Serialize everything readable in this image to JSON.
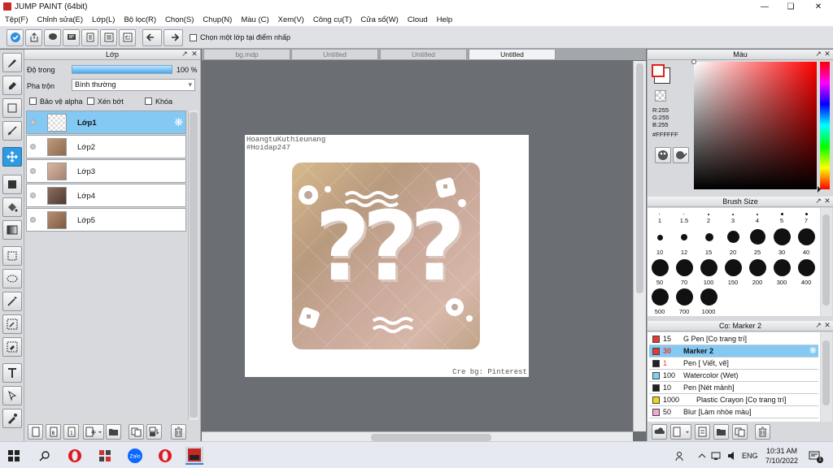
{
  "window": {
    "title": "JUMP PAINT (64bit)"
  },
  "menu": [
    "Tệp(F)",
    "Chỉnh sửa(E)",
    "Lớp(L)",
    "Bộ lọc(R)",
    "Chọn(S)",
    "Chụp(N)",
    "Màu (C)",
    "Xem(V)",
    "Công cụ(T)",
    "Cửa sổ(W)",
    "Cloud",
    "Help"
  ],
  "toolbar": {
    "select_layer_label": "Chọn một lớp tại điểm nhấp"
  },
  "layer_panel": {
    "title": "Lớp",
    "opacity_label": "Độ trong",
    "opacity_value": "100 %",
    "opacity_fraction": 1.0,
    "blend_label": "Pha trộn",
    "blend_value": "Bình thường",
    "protect_alpha": "Bảo vệ alpha",
    "clipping": "Xén bớt",
    "lock": "Khóa",
    "layers": [
      "Lớp1",
      "Lớp2",
      "Lớp3",
      "Lớp4",
      "Lớp5"
    ]
  },
  "tabs": [
    "bg.mdp",
    "Untitled",
    "Untitled",
    "Untitled"
  ],
  "canvas": {
    "watermark_line1": "HoangtuKuthieunang",
    "watermark_line2": "#Hoidap247",
    "credit": "Cre bg: Pinterest",
    "question_marks": "???"
  },
  "color_panel": {
    "title": "Màu",
    "r": "R:255",
    "g": "G:255",
    "b": "B:255",
    "hex": "#FFFFFF",
    "accent": "#ff2a2a"
  },
  "brush_size_panel": {
    "title": "Brush Size",
    "sizes": [
      "1",
      "1.5",
      "2",
      "3",
      "4",
      "5",
      "7",
      "10",
      "12",
      "15",
      "20",
      "25",
      "30",
      "40",
      "50",
      "70",
      "100",
      "150",
      "200",
      "300",
      "400",
      "500",
      "700",
      "1000"
    ]
  },
  "brush_panel": {
    "title": "Cọ: Marker 2",
    "brushes": [
      {
        "size": "15",
        "name": "G Pen [Cọ trang trí]",
        "color": "#e53935"
      },
      {
        "size": "30",
        "name": "Marker 2",
        "color": "#e53935"
      },
      {
        "size": "1",
        "name": "Pen [ Viết, vẽ]",
        "color": "#222222"
      },
      {
        "size": "100",
        "name": "Watercolor (Wet)",
        "color": "#7fd0f0"
      },
      {
        "size": "10",
        "name": "Pen [Nét mảnh]",
        "color": "#222222"
      },
      {
        "size": "1000",
        "name": "Plastic Crayon [Cọ trang trí]",
        "color": "#f2d31b"
      },
      {
        "size": "50",
        "name": "Blur [Làm nhòe màu]",
        "color": "#f4a6d7"
      }
    ]
  },
  "taskbar": {
    "time": "10:31 AM",
    "date": "7/10/2022",
    "lang": "ENG"
  }
}
